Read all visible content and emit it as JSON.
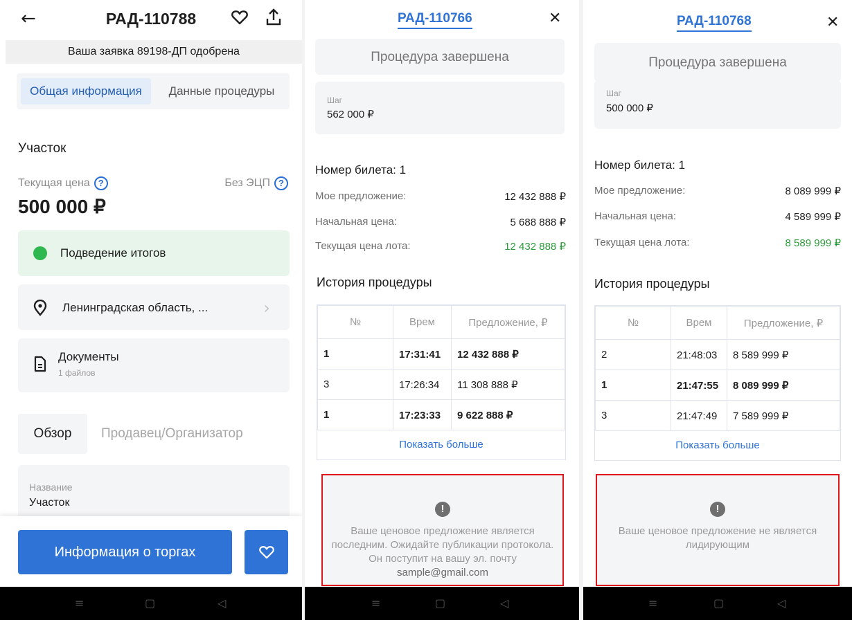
{
  "colors": {
    "accent": "#2f73d6",
    "success": "#2fb84f",
    "green_text": "#2f9a3c",
    "alert_border": "#e0161b"
  },
  "screen1": {
    "title": "РАД-110788",
    "approval": "Ваша заявка 89198-ДП одобрена",
    "tabs": [
      "Общая информация",
      "Данные процедуры"
    ],
    "lot_name": "Участок",
    "price_label": "Текущая цена",
    "no_ecp": "Без ЭЦП",
    "price": "500 000 ₽",
    "status": "Подведение итогов",
    "location": "Ленинградская область, ...",
    "docs_title": "Документы",
    "docs_count": "1 файлов",
    "subtabs": [
      "Обзор",
      "Продавец/Организатор"
    ],
    "field_label": "Название",
    "field_value": "Участок",
    "button": "Информация о торгах",
    "help_glyph": "?"
  },
  "screen2": {
    "title": "РАД-110766",
    "procedure_status": "Процедура завершена",
    "step_label": "Шаг",
    "step_value": "562 000 ₽",
    "ticket": "Номер билета: 1",
    "my_offer_label": "Мое предложение:",
    "my_offer": "12 432 888 ₽",
    "start_price_label": "Начальная цена:",
    "start_price": "5 688 888 ₽",
    "current_price_label": "Текущая цена лота:",
    "current_price": "12 432 888 ₽",
    "history_title": "История процедуры",
    "table_headers": [
      "№",
      "Врем",
      "Предложение, ₽"
    ],
    "rows": [
      {
        "n": "1",
        "time": "17:31:41",
        "offer": "12 432 888 ₽"
      },
      {
        "n": "3",
        "time": "17:26:34",
        "offer": "11 308 888 ₽"
      },
      {
        "n": "1",
        "time": "17:23:33",
        "offer": "9 622 888 ₽"
      }
    ],
    "show_more": "Показать больше",
    "alert_glyph": "!",
    "alert_text": "Ваше ценовое предложение является последним. Ожидайте публикации протокола. Он поступит на вашу эл. почту",
    "alert_email": "sample@gmail.com"
  },
  "screen3": {
    "title": "РАД-110768",
    "procedure_status": "Процедура завершена",
    "step_label": "Шаг",
    "step_value": "500 000 ₽",
    "ticket": "Номер билета: 1",
    "my_offer_label": "Мое предложение:",
    "my_offer": "8 089 999 ₽",
    "start_price_label": "Начальная цена:",
    "start_price": "4 589 999 ₽",
    "current_price_label": "Текущая цена лота:",
    "current_price": "8 589 999 ₽",
    "history_title": "История процедуры",
    "table_headers": [
      "№",
      "Врем",
      "Предложение, ₽"
    ],
    "rows": [
      {
        "n": "2",
        "time": "21:48:03",
        "offer": "8 589 999 ₽"
      },
      {
        "n": "1",
        "time": "21:47:55",
        "offer": "8 089 999 ₽"
      },
      {
        "n": "3",
        "time": "21:47:49",
        "offer": "7 589 999 ₽"
      }
    ],
    "show_more": "Показать больше",
    "alert_glyph": "!",
    "alert_text": "Ваше ценовое предложение не является лидирующим"
  },
  "nav_icons": [
    "menu-icon",
    "home-icon",
    "back-triangle-icon"
  ]
}
